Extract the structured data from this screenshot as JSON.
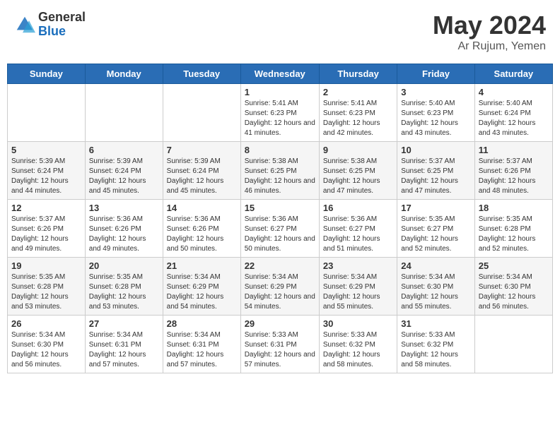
{
  "header": {
    "logo_general": "General",
    "logo_blue": "Blue",
    "month": "May 2024",
    "location": "Ar Rujum, Yemen"
  },
  "days_of_week": [
    "Sunday",
    "Monday",
    "Tuesday",
    "Wednesday",
    "Thursday",
    "Friday",
    "Saturday"
  ],
  "weeks": [
    [
      {
        "day": "",
        "info": ""
      },
      {
        "day": "",
        "info": ""
      },
      {
        "day": "",
        "info": ""
      },
      {
        "day": "1",
        "info": "Sunrise: 5:41 AM\nSunset: 6:23 PM\nDaylight: 12 hours\nand 41 minutes."
      },
      {
        "day": "2",
        "info": "Sunrise: 5:41 AM\nSunset: 6:23 PM\nDaylight: 12 hours\nand 42 minutes."
      },
      {
        "day": "3",
        "info": "Sunrise: 5:40 AM\nSunset: 6:23 PM\nDaylight: 12 hours\nand 43 minutes."
      },
      {
        "day": "4",
        "info": "Sunrise: 5:40 AM\nSunset: 6:24 PM\nDaylight: 12 hours\nand 43 minutes."
      }
    ],
    [
      {
        "day": "5",
        "info": "Sunrise: 5:39 AM\nSunset: 6:24 PM\nDaylight: 12 hours\nand 44 minutes."
      },
      {
        "day": "6",
        "info": "Sunrise: 5:39 AM\nSunset: 6:24 PM\nDaylight: 12 hours\nand 45 minutes."
      },
      {
        "day": "7",
        "info": "Sunrise: 5:39 AM\nSunset: 6:24 PM\nDaylight: 12 hours\nand 45 minutes."
      },
      {
        "day": "8",
        "info": "Sunrise: 5:38 AM\nSunset: 6:25 PM\nDaylight: 12 hours\nand 46 minutes."
      },
      {
        "day": "9",
        "info": "Sunrise: 5:38 AM\nSunset: 6:25 PM\nDaylight: 12 hours\nand 47 minutes."
      },
      {
        "day": "10",
        "info": "Sunrise: 5:37 AM\nSunset: 6:25 PM\nDaylight: 12 hours\nand 47 minutes."
      },
      {
        "day": "11",
        "info": "Sunrise: 5:37 AM\nSunset: 6:26 PM\nDaylight: 12 hours\nand 48 minutes."
      }
    ],
    [
      {
        "day": "12",
        "info": "Sunrise: 5:37 AM\nSunset: 6:26 PM\nDaylight: 12 hours\nand 49 minutes."
      },
      {
        "day": "13",
        "info": "Sunrise: 5:36 AM\nSunset: 6:26 PM\nDaylight: 12 hours\nand 49 minutes."
      },
      {
        "day": "14",
        "info": "Sunrise: 5:36 AM\nSunset: 6:26 PM\nDaylight: 12 hours\nand 50 minutes."
      },
      {
        "day": "15",
        "info": "Sunrise: 5:36 AM\nSunset: 6:27 PM\nDaylight: 12 hours\nand 50 minutes."
      },
      {
        "day": "16",
        "info": "Sunrise: 5:36 AM\nSunset: 6:27 PM\nDaylight: 12 hours\nand 51 minutes."
      },
      {
        "day": "17",
        "info": "Sunrise: 5:35 AM\nSunset: 6:27 PM\nDaylight: 12 hours\nand 52 minutes."
      },
      {
        "day": "18",
        "info": "Sunrise: 5:35 AM\nSunset: 6:28 PM\nDaylight: 12 hours\nand 52 minutes."
      }
    ],
    [
      {
        "day": "19",
        "info": "Sunrise: 5:35 AM\nSunset: 6:28 PM\nDaylight: 12 hours\nand 53 minutes."
      },
      {
        "day": "20",
        "info": "Sunrise: 5:35 AM\nSunset: 6:28 PM\nDaylight: 12 hours\nand 53 minutes."
      },
      {
        "day": "21",
        "info": "Sunrise: 5:34 AM\nSunset: 6:29 PM\nDaylight: 12 hours\nand 54 minutes."
      },
      {
        "day": "22",
        "info": "Sunrise: 5:34 AM\nSunset: 6:29 PM\nDaylight: 12 hours\nand 54 minutes."
      },
      {
        "day": "23",
        "info": "Sunrise: 5:34 AM\nSunset: 6:29 PM\nDaylight: 12 hours\nand 55 minutes."
      },
      {
        "day": "24",
        "info": "Sunrise: 5:34 AM\nSunset: 6:30 PM\nDaylight: 12 hours\nand 55 minutes."
      },
      {
        "day": "25",
        "info": "Sunrise: 5:34 AM\nSunset: 6:30 PM\nDaylight: 12 hours\nand 56 minutes."
      }
    ],
    [
      {
        "day": "26",
        "info": "Sunrise: 5:34 AM\nSunset: 6:30 PM\nDaylight: 12 hours\nand 56 minutes."
      },
      {
        "day": "27",
        "info": "Sunrise: 5:34 AM\nSunset: 6:31 PM\nDaylight: 12 hours\nand 57 minutes."
      },
      {
        "day": "28",
        "info": "Sunrise: 5:34 AM\nSunset: 6:31 PM\nDaylight: 12 hours\nand 57 minutes."
      },
      {
        "day": "29",
        "info": "Sunrise: 5:33 AM\nSunset: 6:31 PM\nDaylight: 12 hours\nand 57 minutes."
      },
      {
        "day": "30",
        "info": "Sunrise: 5:33 AM\nSunset: 6:32 PM\nDaylight: 12 hours\nand 58 minutes."
      },
      {
        "day": "31",
        "info": "Sunrise: 5:33 AM\nSunset: 6:32 PM\nDaylight: 12 hours\nand 58 minutes."
      },
      {
        "day": "",
        "info": ""
      }
    ]
  ]
}
